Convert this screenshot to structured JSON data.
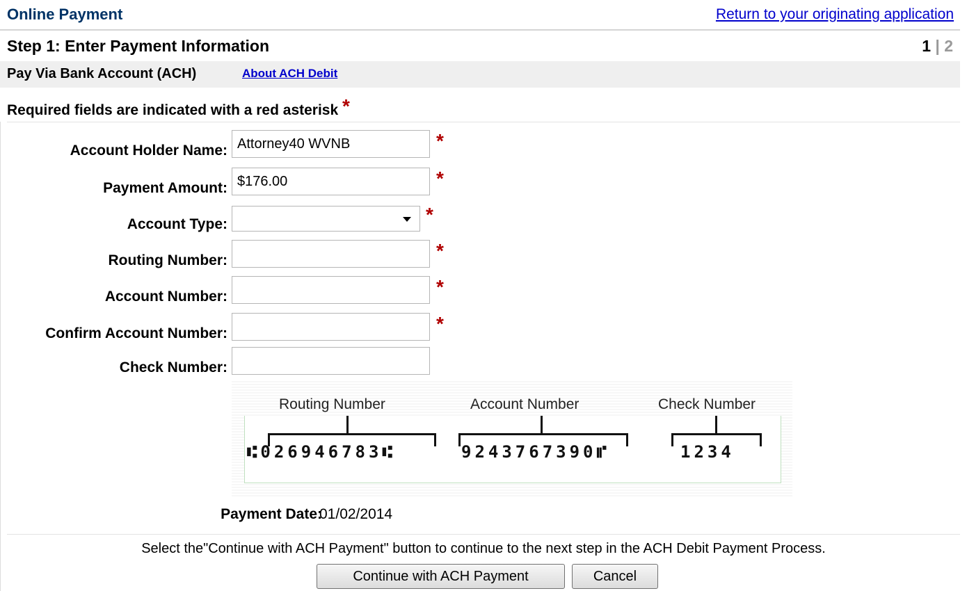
{
  "header": {
    "title": "Online Payment",
    "return_link": "Return to your originating application"
  },
  "step": {
    "title": "Step 1: Enter Payment Information",
    "current": "1",
    "separator": "|",
    "next": "2"
  },
  "method": {
    "label": "Pay Via Bank Account (ACH)",
    "about_link": "About ACH Debit"
  },
  "required_note": {
    "text": "Required fields are indicated with a red asterisk",
    "asterisk": "*"
  },
  "form": {
    "account_holder_name": {
      "label": "Account Holder Name:",
      "value": "Attorney40 WVNB",
      "required": "*"
    },
    "payment_amount": {
      "label": "Payment Amount:",
      "value": "$176.00",
      "required": "*"
    },
    "account_type": {
      "label": "Account Type:",
      "value": "",
      "required": "*"
    },
    "routing_number": {
      "label": "Routing Number:",
      "value": "",
      "required": "*"
    },
    "account_number": {
      "label": "Account Number:",
      "value": "",
      "required": "*"
    },
    "confirm_account_number": {
      "label": "Confirm Account Number:",
      "value": "",
      "required": "*"
    },
    "check_number": {
      "label": "Check Number:",
      "value": ""
    }
  },
  "check_image": {
    "routing_label": "Routing Number",
    "account_label": "Account Number",
    "check_label": "Check Number",
    "routing_digits": "⑆026946783⑆",
    "account_digits": "9243767390⑈",
    "check_digits": "1234"
  },
  "payment_date": {
    "label": "Payment Date:",
    "value": "01/02/2014"
  },
  "instructions": "Select the\"Continue with ACH Payment\" button to continue to the next step in the ACH Debit Payment Process.",
  "buttons": {
    "continue": "Continue with ACH Payment",
    "cancel": "Cancel"
  },
  "colors": {
    "title_blue": "#003366",
    "link_blue": "#0000cc",
    "required_red": "#b00000",
    "section_gray": "#efefef"
  }
}
